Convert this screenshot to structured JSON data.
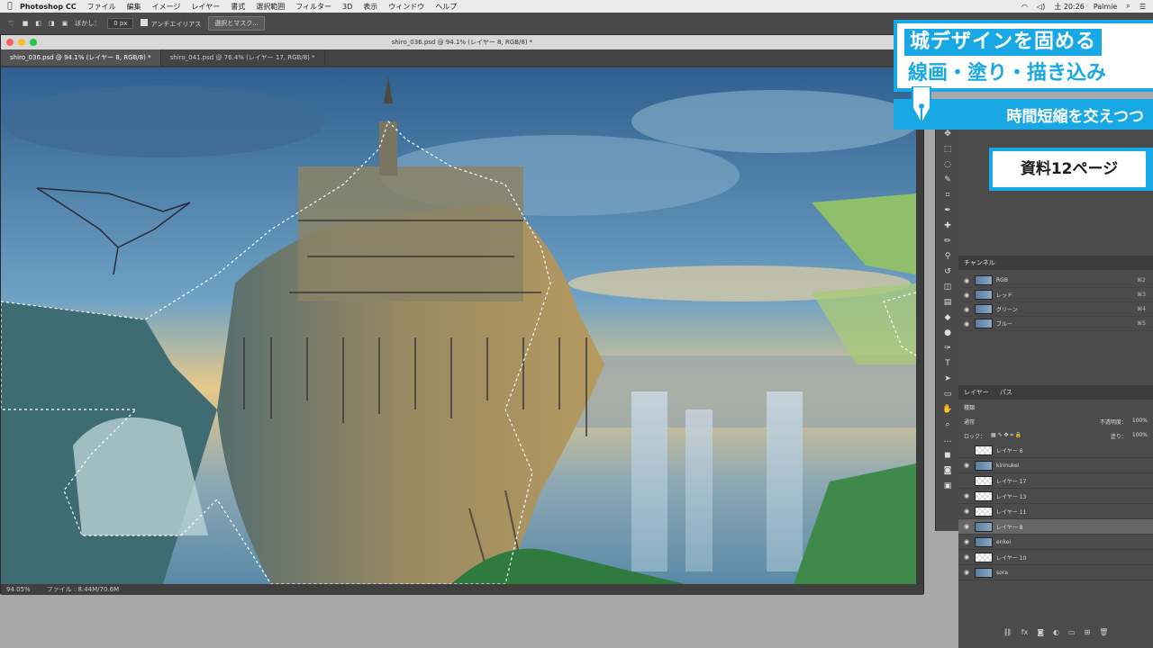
{
  "menubar": {
    "app": "Photoshop CC",
    "items": [
      "ファイル",
      "編集",
      "イメージ",
      "レイヤー",
      "書式",
      "選択範囲",
      "フィルター",
      "3D",
      "表示",
      "ウィンドウ",
      "ヘルプ"
    ],
    "time": "土 20:26",
    "user": "Palmie"
  },
  "options": {
    "feather_label": "ぼかし：",
    "feather_value": "0 px",
    "antialias_label": "アンチエイリアス",
    "select_mask": "選択とマスク..."
  },
  "document": {
    "window_title": "shiro_036.psd @ 94.1% (レイヤー 8, RGB/8) *",
    "tabs": [
      "shiro_036.psd @ 94.1% (レイヤー 8, RGB/8) *",
      "shiro_041.psd @ 76.4% (レイヤー 17, RGB/8) *"
    ],
    "zoom": "94.05%",
    "file_info": "ファイル : 8.44M/70.6M"
  },
  "channels": {
    "tab": "チャンネル",
    "rows": [
      {
        "name": "RGB",
        "shortcut": "⌘2"
      },
      {
        "name": "レッド",
        "shortcut": "⌘3"
      },
      {
        "name": "グリーン",
        "shortcut": "⌘4"
      },
      {
        "name": "ブルー",
        "shortcut": "⌘5"
      }
    ]
  },
  "layers": {
    "tab_layers": "レイヤー",
    "tab_paths": "パス",
    "kind": "種類",
    "blend": "通常",
    "opacity_label": "不透明度：",
    "opacity": "100%",
    "lock_label": "ロック：",
    "fill_label": "塗り：",
    "fill": "100%",
    "rows": [
      {
        "name": "レイヤー 6",
        "visible": false
      },
      {
        "name": "kirinukei",
        "visible": true
      },
      {
        "name": "レイヤー 17",
        "visible": false
      },
      {
        "name": "レイヤー 13",
        "visible": true
      },
      {
        "name": "レイヤー 11",
        "visible": true
      },
      {
        "name": "レイヤー 8",
        "visible": true,
        "selected": true
      },
      {
        "name": "enkei",
        "visible": true
      },
      {
        "name": "レイヤー 10",
        "visible": true
      },
      {
        "name": "sora",
        "visible": true
      }
    ]
  },
  "overlay": {
    "line1": "城デザインを固める",
    "line2": "線画・塗り・描き込み",
    "line3": "時間短縮を交えつつ",
    "ref": "資料12ページ"
  }
}
